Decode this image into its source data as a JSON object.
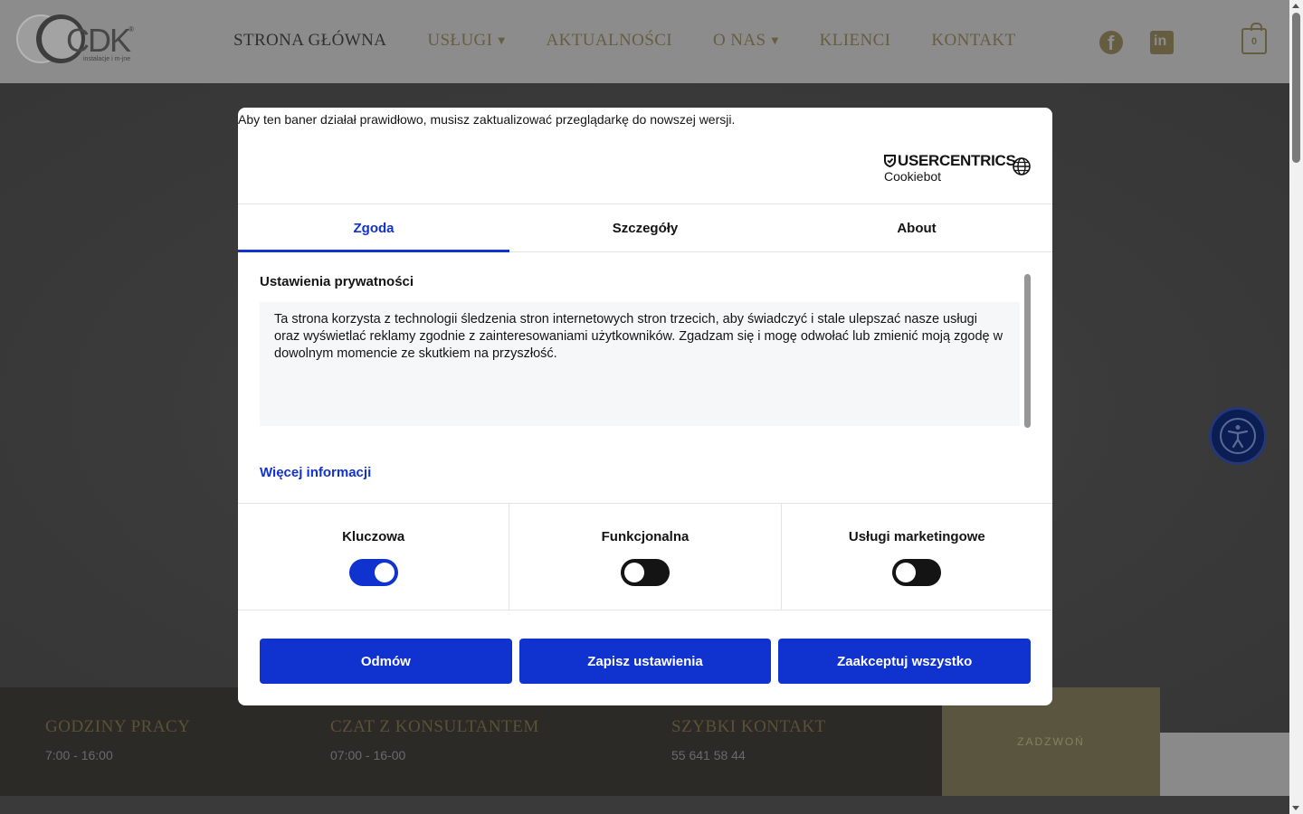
{
  "header": {
    "logo_text": "CDK",
    "logo_reg": "®",
    "logo_sub": "instalacje i m-jne",
    "nav": [
      {
        "label": "STRONA GŁÓWNA",
        "active": true,
        "has_dropdown": false
      },
      {
        "label": "USŁUGI",
        "active": false,
        "has_dropdown": true
      },
      {
        "label": "AKTUALNOŚCI",
        "active": false,
        "has_dropdown": false
      },
      {
        "label": "O NAS",
        "active": false,
        "has_dropdown": true
      },
      {
        "label": "KLIENCI",
        "active": false,
        "has_dropdown": false
      },
      {
        "label": "KONTAKT",
        "active": false,
        "has_dropdown": false
      }
    ],
    "social_icons": [
      "facebook-icon",
      "linkedin-icon"
    ],
    "cart_count": "0"
  },
  "info_bar": {
    "columns": [
      {
        "title": "GODZINY PRACY",
        "value": "7:00 - 16:00"
      },
      {
        "title": "CZAT Z KONSULTANTEM",
        "value": "07:00 - 16-00"
      },
      {
        "title": "SZYBKI KONTAKT",
        "value": "55 641 58 44"
      }
    ],
    "call_label": "ZADZWOŃ"
  },
  "cookie_dialog": {
    "warning": "Aby ten baner działał prawidłowo, musisz zaktualizować przeglądarkę do nowszej wersji.",
    "brand_name": "USERCENTRICS",
    "brand_sub": "Cookiebot",
    "tabs": [
      {
        "label": "Zgoda",
        "active": true
      },
      {
        "label": "Szczegóły",
        "active": false
      },
      {
        "label": "About",
        "active": false
      }
    ],
    "heading": "Ustawienia prywatności",
    "body": "Ta strona korzysta z technologii śledzenia stron internetowych stron trzecich, aby świadczyć i stale ulepszać nasze usługi oraz wyświetlać reklamy zgodnie z zainteresowaniami użytkowników. Zgadzam się i mogę odwołać lub zmienić moją zgodę w dowolnym momencie ze skutkiem na przyszłość.",
    "more_link": "Więcej informacji",
    "categories": [
      {
        "label": "Kluczowa",
        "enabled": true
      },
      {
        "label": "Funkcjonalna",
        "enabled": false
      },
      {
        "label": "Usługi marketingowe",
        "enabled": false
      }
    ],
    "buttons": {
      "deny": "Odmów",
      "save": "Zapisz ustawienia",
      "accept_all": "Zaakceptuj wszystko"
    }
  },
  "colors": {
    "primary_blue": "#1032cf",
    "gold": "#675d41"
  }
}
